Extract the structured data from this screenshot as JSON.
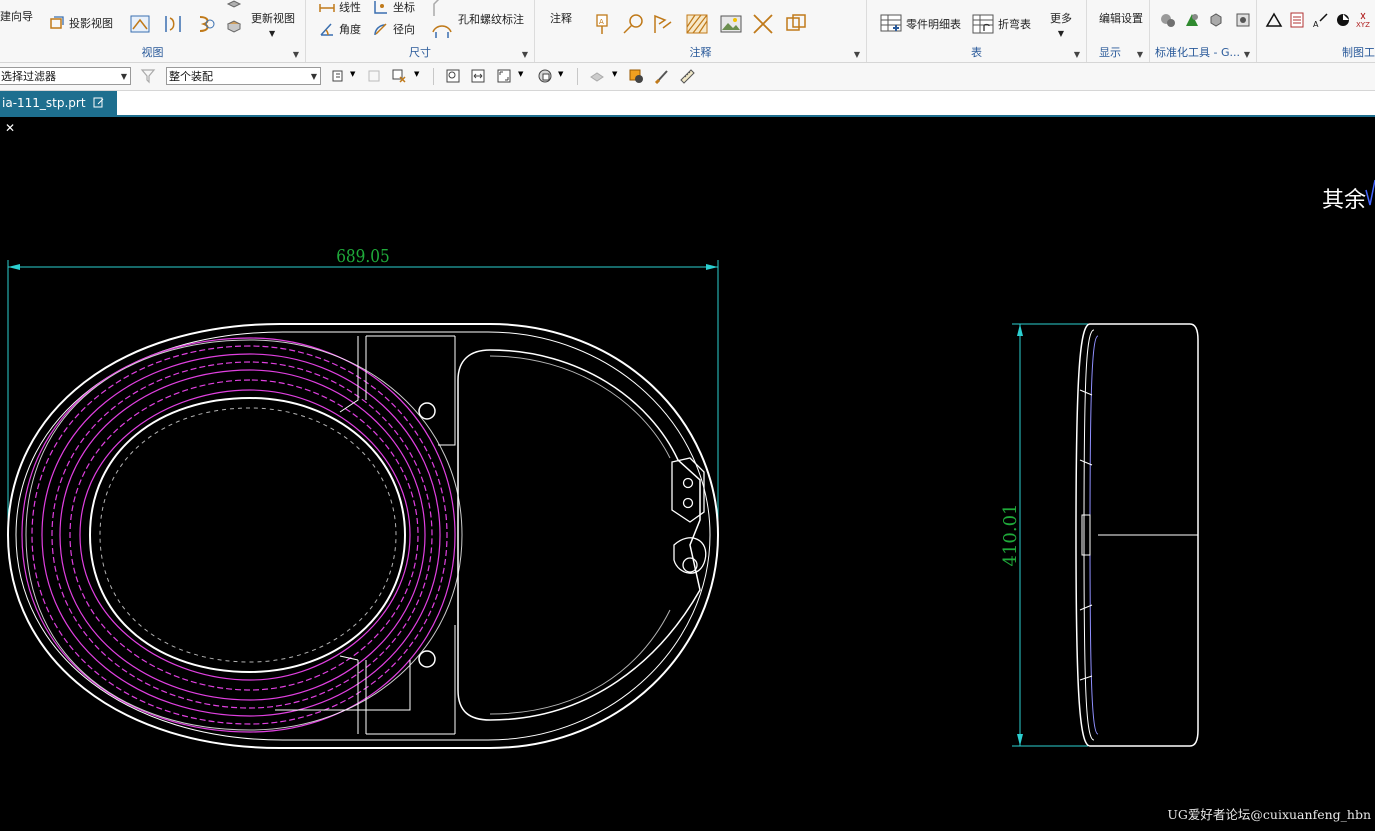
{
  "ribbon": {
    "view_group": {
      "label": "视图",
      "wizard": "建向导",
      "projected_view": "投影视图",
      "update_view": "更新视图"
    },
    "dim_group": {
      "label": "尺寸",
      "linear": "线性",
      "coordinate": "坐标",
      "angle": "角度",
      "radial": "径向",
      "hole_thread": "孔和螺纹标注"
    },
    "annotation_group": {
      "label": "注释",
      "note": "注释"
    },
    "table_group": {
      "label": "表",
      "parts_list": "零件明细表",
      "bend_table": "折弯表",
      "more": "更多"
    },
    "display_group": {
      "label": "显示",
      "edit_settings": "编辑设置"
    },
    "std_tools_group": {
      "label": "标准化工具 - G..."
    },
    "draft_tools_group": {
      "label": "制图工"
    }
  },
  "toolbar": {
    "filter_placeholder": "选择过滤器",
    "scope": "整个装配"
  },
  "document_tab": {
    "title": "ia-111_stp.prt",
    "close": "✕"
  },
  "drawing": {
    "width_dim": "689.05",
    "height_dim": "410.01",
    "surface_note": "其余",
    "watermark": "UG爱好者论坛@cuixuanfeng_hbn"
  },
  "colors": {
    "dimension": "#2ccfd0",
    "dim_text": "#1faa3a",
    "outline": "#ffffff",
    "hidden": "#e040e0",
    "tab": "#1e6f8f"
  }
}
